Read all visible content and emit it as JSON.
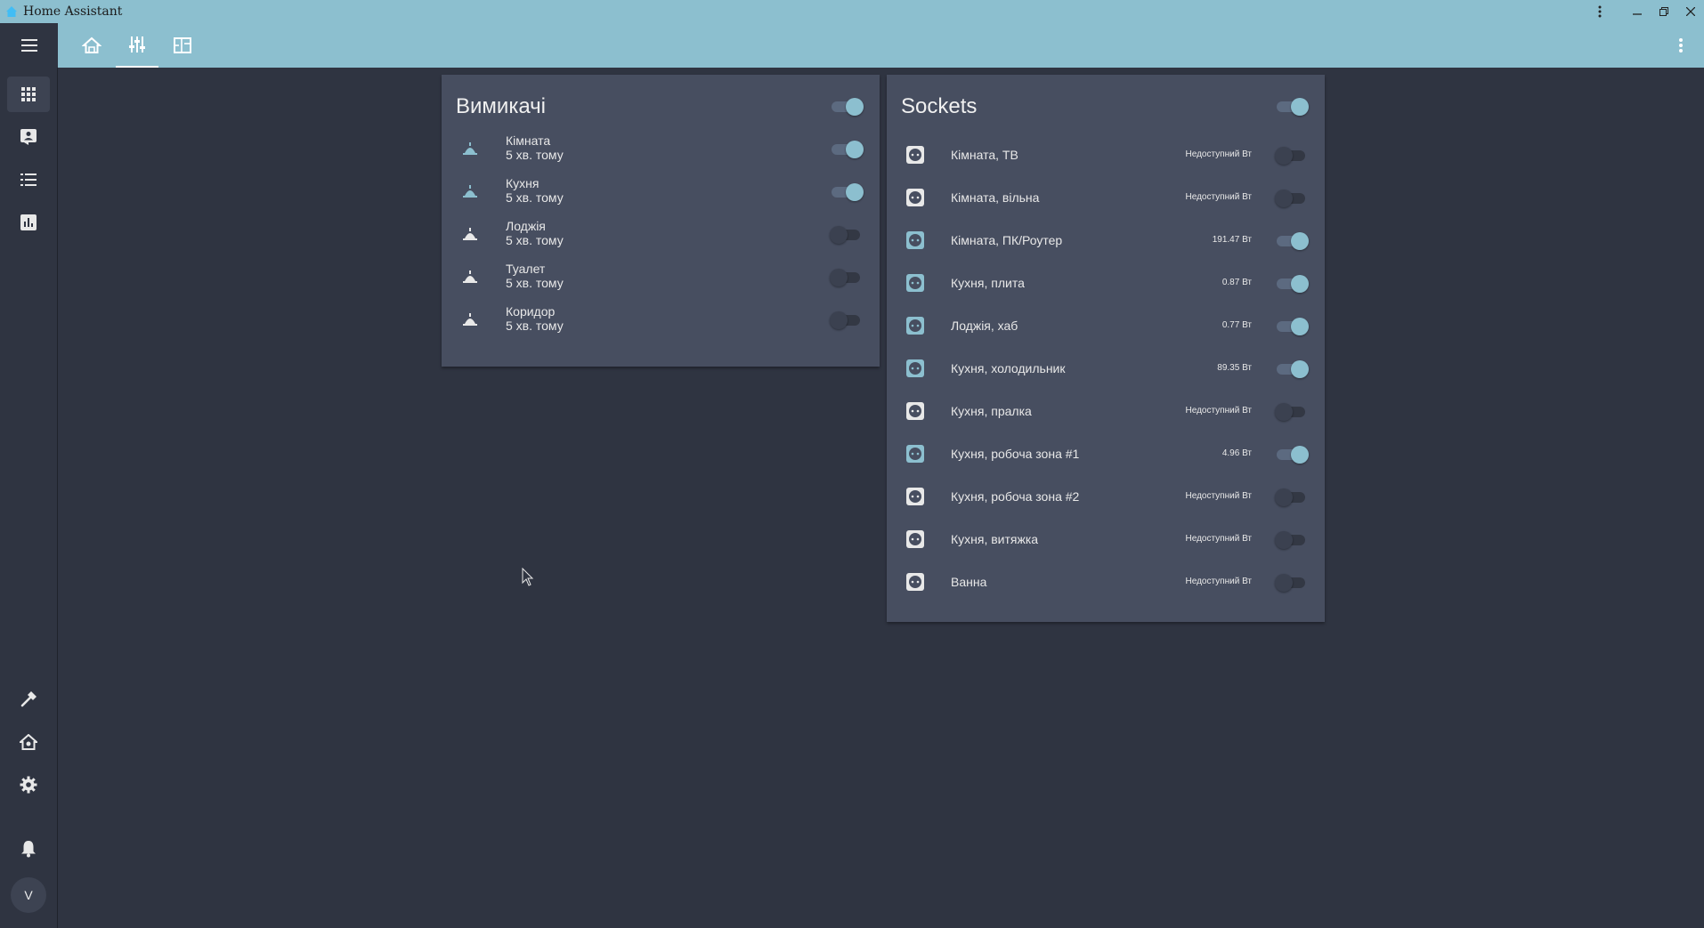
{
  "window": {
    "title": "Home Assistant"
  },
  "colors": {
    "accent": "#8cbfcf",
    "background": "#2f3441",
    "card": "#474e60"
  },
  "header": {
    "tabs": [
      {
        "icon": "home-outline-icon",
        "active": false
      },
      {
        "icon": "tune-icon",
        "active": true
      },
      {
        "icon": "floor-plan-icon",
        "active": false
      }
    ]
  },
  "sidebar": {
    "items": [
      {
        "icon": "view-dashboard-icon"
      },
      {
        "icon": "account-box-icon"
      },
      {
        "icon": "format-list-icon"
      },
      {
        "icon": "chart-box-icon"
      }
    ],
    "bottom_items": [
      {
        "icon": "hammer-icon"
      },
      {
        "icon": "home-automation-icon"
      },
      {
        "icon": "cog-icon"
      },
      {
        "icon": "bell-icon"
      }
    ],
    "user_initial": "V"
  },
  "switches_card": {
    "title": "Вимикачі",
    "header_on": true,
    "items": [
      {
        "name": "Кімната",
        "time": "5 хв. тому",
        "on": true
      },
      {
        "name": "Кухня",
        "time": "5 хв. тому",
        "on": true
      },
      {
        "name": "Лоджія",
        "time": "5 хв. тому",
        "on": false
      },
      {
        "name": "Туалет",
        "time": "5 хв. тому",
        "on": false
      },
      {
        "name": "Коридор",
        "time": "5 хв. тому",
        "on": false
      }
    ]
  },
  "sockets_card": {
    "title": "Sockets",
    "header_on": true,
    "items": [
      {
        "name": "Кімната, ТВ",
        "power": "Недоступний Вт",
        "on": false
      },
      {
        "name": "Кімната, вільна",
        "power": "Недоступний Вт",
        "on": false
      },
      {
        "name": "Кімната, ПК/Роутер",
        "power": "191.47 Вт",
        "on": true
      },
      {
        "name": "Кухня, плита",
        "power": "0.87 Вт",
        "on": true
      },
      {
        "name": "Лоджія, хаб",
        "power": "0.77 Вт",
        "on": true
      },
      {
        "name": "Кухня, холодильник",
        "power": "89.35 Вт",
        "on": true
      },
      {
        "name": "Кухня, пралка",
        "power": "Недоступний Вт",
        "on": false
      },
      {
        "name": "Кухня, робоча зона #1",
        "power": "4.96 Вт",
        "on": true
      },
      {
        "name": "Кухня, робоча зона #2",
        "power": "Недоступний Вт",
        "on": false
      },
      {
        "name": "Кухня, витяжка",
        "power": "Недоступний Вт",
        "on": false
      },
      {
        "name": "Ванна",
        "power": "Недоступний Вт",
        "on": false
      }
    ]
  }
}
